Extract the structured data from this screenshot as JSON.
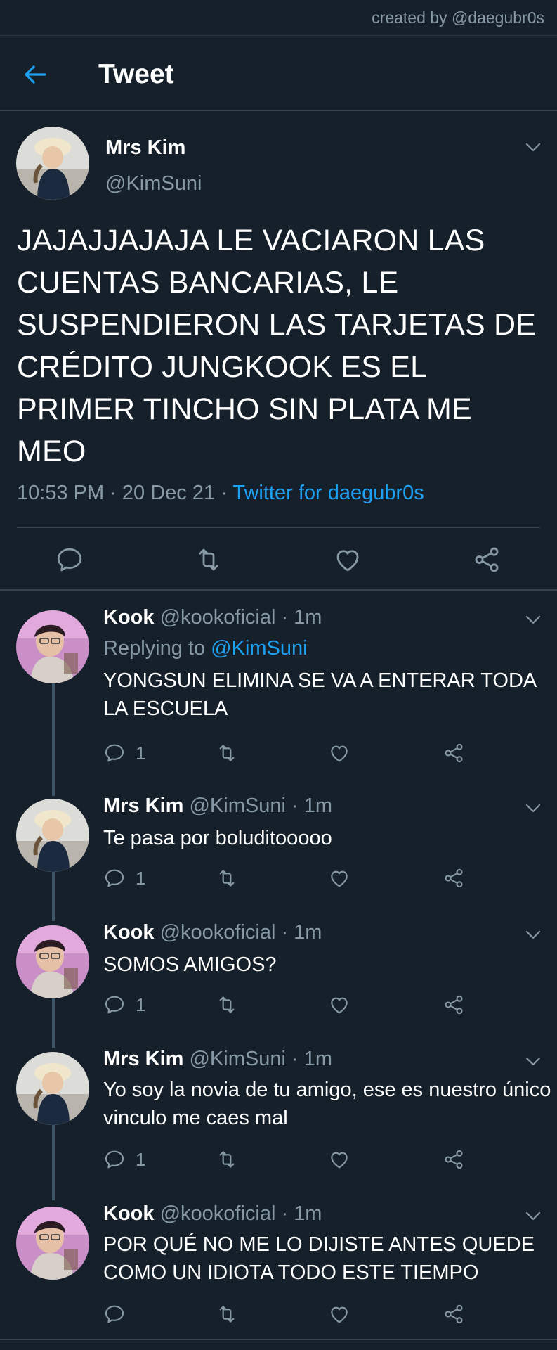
{
  "credit": "created by @daegubr0s",
  "header": {
    "title": "Tweet"
  },
  "main_tweet": {
    "name": "Mrs Kim",
    "handle": "@KimSuni",
    "text": "JAJAJJAJAJA LE VACIARON LAS CUENTAS BANCARIAS, LE SUSPENDIERON LAS TARJETAS DE CRÉDITO JUNGKOOK ES EL PRIMER TINCHO SIN PLATA ME MEO",
    "time": "10:53 PM",
    "date": "20 Dec 21",
    "separator": " · ",
    "source": "Twitter for daegubr0s"
  },
  "replies": [
    {
      "name": "Kook",
      "handle": "@kookoficial",
      "time": "· 1m",
      "replying_prefix": "Replying to ",
      "replying_to": "@KimSuni",
      "text": "YONGSUN ELIMINA SE VA A ENTERAR TODA LA ESCUELA",
      "reply_count": "1"
    },
    {
      "name": "Mrs Kim",
      "handle": "@KimSuni",
      "time": "· 1m",
      "text": "Te pasa por boluditooooo",
      "reply_count": "1"
    },
    {
      "name": "Kook",
      "handle": "@kookoficial",
      "time": "· 1m",
      "text": "SOMOS AMIGOS?",
      "reply_count": "1"
    },
    {
      "name": "Mrs Kim",
      "handle": "@KimSuni",
      "time": "· 1m",
      "text": "Yo soy la novia de tu amigo, ese es nuestro único vinculo me caes mal",
      "reply_count": "1"
    },
    {
      "name": "Kook",
      "handle": "@kookoficial",
      "time": "· 1m",
      "text": "POR QUÉ NO ME LO DIJISTE ANTES QUEDE COMO UN IDIOTA TODO ESTE TIEMPO",
      "reply_count": ""
    }
  ],
  "colors": {
    "background": "#15202b",
    "accent": "#1da1f2",
    "secondary_text": "#8899a6",
    "divider": "#38444d"
  },
  "icons": [
    "back-arrow-icon",
    "chevron-down-icon",
    "reply-icon",
    "retweet-icon",
    "like-icon",
    "share-icon"
  ]
}
